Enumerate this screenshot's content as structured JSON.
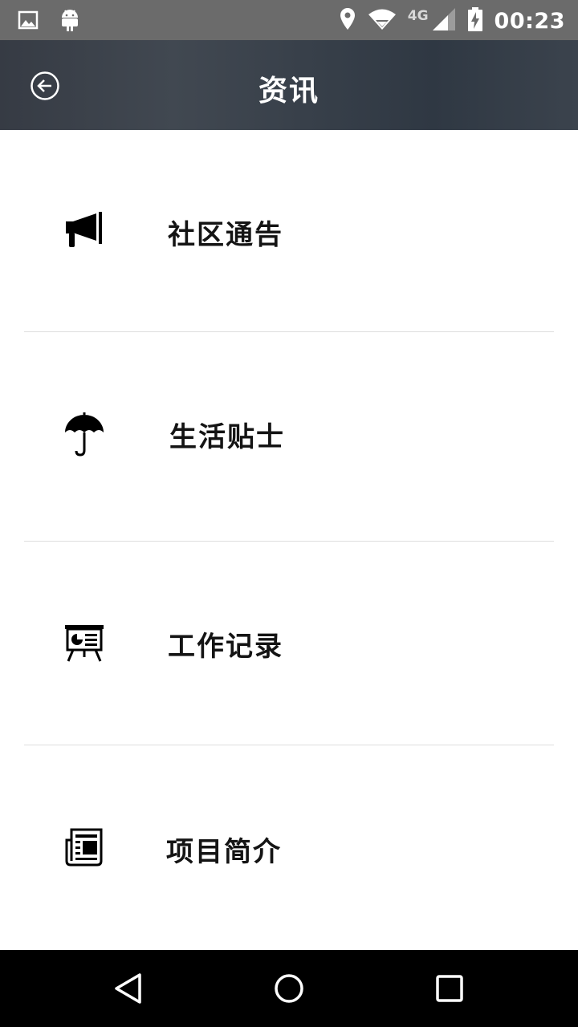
{
  "status_bar": {
    "network_type": "4G",
    "time": "00:23",
    "left_icons": [
      "image-notification-icon",
      "android-icon"
    ],
    "right_icons": [
      "location-icon",
      "wifi-icon",
      "cell-signal-icon",
      "battery-charging-icon"
    ]
  },
  "app_bar": {
    "title": "资讯",
    "back_icon": "back-arrow-circle-icon",
    "background": "#363b44"
  },
  "menu": {
    "items": [
      {
        "label": "社区通告",
        "icon": "megaphone-icon"
      },
      {
        "label": "生活贴士",
        "icon": "umbrella-icon"
      },
      {
        "label": "工作记录",
        "icon": "presentation-board-icon"
      },
      {
        "label": "项目简介",
        "icon": "newspaper-icon"
      }
    ]
  },
  "nav_bar": {
    "buttons": [
      "back-triangle-icon",
      "home-circle-icon",
      "recents-square-icon"
    ]
  }
}
